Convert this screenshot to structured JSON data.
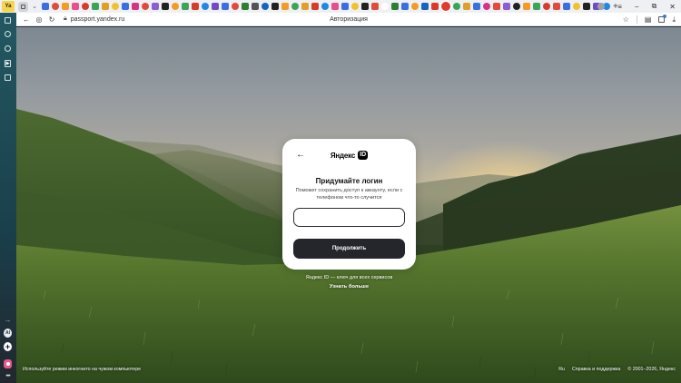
{
  "browser": {
    "logo_text": "Ya",
    "url": "passport.yandex.ru",
    "page_title": "Авторизация",
    "tab_favicon_colors": [
      "#3b6fe0",
      "#e04b3c",
      "#f39b27",
      "#e94f8b",
      "#d93b2b",
      "#3aa55a",
      "#e0a028",
      "#f2c12e",
      "#3b6fe0",
      "#d63384",
      "#e24a3b",
      "#8a5cd6",
      "#222222",
      "#f39b27",
      "#3aa55a",
      "#d93b2b",
      "#1e88e5",
      "#6d4cc4",
      "#3b6fe0",
      "#e04b3c",
      "#2e7d32",
      "#555555",
      "#1565c0",
      "#222222",
      "#f39b27",
      "#3aa55a",
      "#e0a028",
      "#d93b2b",
      "#1e88e5",
      "#e94f8b",
      "#3b6fe0",
      "#f2c12e",
      "#222222",
      "#e04b3c",
      "#ffffff",
      "#2e7d32",
      "#3b6fe0",
      "#f39b27",
      "#1565c0",
      "#d93b2b",
      "#3aa55a",
      "#e0a028",
      "#3b6fe0",
      "#d63384",
      "#e24a3b",
      "#8a5cd6",
      "#222222",
      "#f39b27",
      "#3aa55a",
      "#d93b2b",
      "#e04b3c",
      "#3b6fe0",
      "#f2c12e",
      "#222222",
      "#6d4cc4",
      "#1e88e5"
    ],
    "active_tab_color": "#e03b2f"
  },
  "card": {
    "back_icon": "←",
    "logo_text": "Яндекс",
    "logo_badge": "ID",
    "title": "Придумайте логин",
    "description": "Поможет сохранить доступ к аккаунту, если с телефоном что-то случится",
    "login_input_value": "",
    "continue_label": "Продолжить"
  },
  "tagline": "Яндекс ID — ключ для всех сервисов",
  "learn_more": "Узнать больше",
  "footer": {
    "incognito_hint": "Используйте режим инкогнито на чужом компьютере",
    "language": "Ru",
    "help": "Справка и поддержка",
    "copyright": "© 2001–2026, Яндекс"
  },
  "sidebar": {
    "alice_label": "AI"
  }
}
